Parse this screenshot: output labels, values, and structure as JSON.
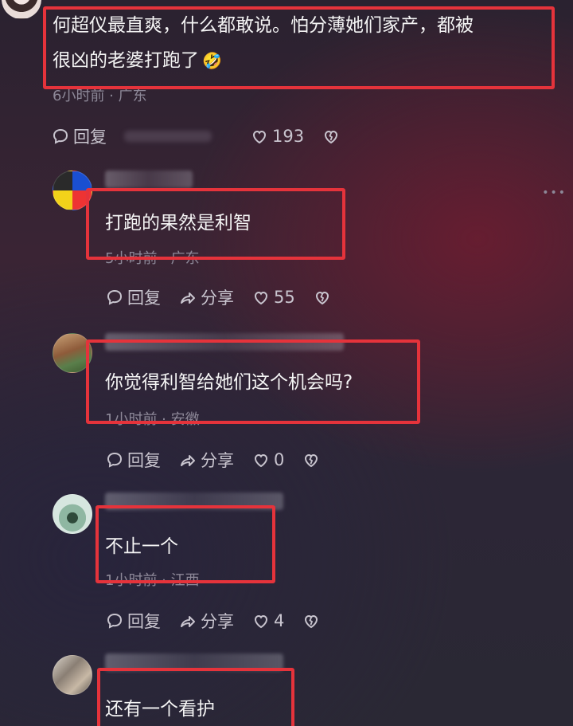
{
  "main_comment": {
    "text_line1": "何超仪最直爽，什么都敢说。怕分薄她们家产，都被",
    "text_line2": "很凶的老婆打跑了",
    "emoji": "🤣",
    "meta": "6小时前 · 广东",
    "reply_label": "回复",
    "likes": "193"
  },
  "replies": [
    {
      "text": "打跑的果然是利智",
      "meta": "5小时前 · 广东",
      "reply_label": "回复",
      "share_label": "分享",
      "likes": "55"
    },
    {
      "text": "你觉得利智给她们这个机会吗?",
      "meta": "1小时前 · 安徽",
      "reply_label": "回复",
      "share_label": "分享",
      "likes": "0"
    },
    {
      "text": "不止一个",
      "meta": "1小时前 · 江西",
      "reply_label": "回复",
      "share_label": "分享",
      "likes": "4"
    },
    {
      "text": "还有一个看护"
    }
  ],
  "colors": {
    "highlight_box": "#e5333b",
    "meta_text": "#8d8898",
    "action_text": "#c9c5cf"
  },
  "icons": {
    "reply": "speech-bubble-icon",
    "share": "share-arrow-icon",
    "like": "heart-outline-icon",
    "dislike": "broken-heart-icon"
  }
}
